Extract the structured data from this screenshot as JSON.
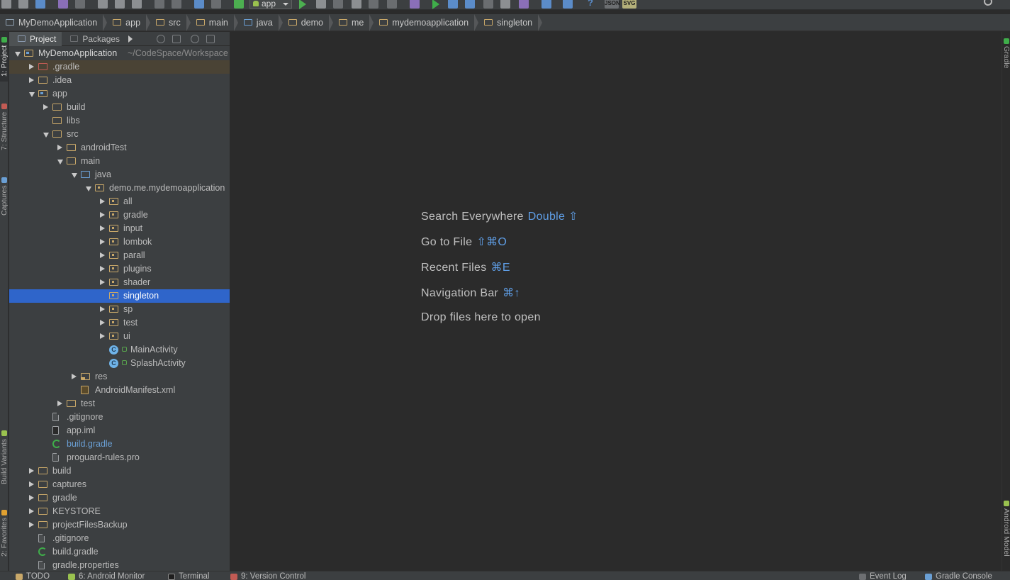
{
  "toolbar": {
    "run_config": "app",
    "json_btn": "JSON",
    "svg_btn": "SVG"
  },
  "breadcrumb": [
    "MyDemoApplication",
    "app",
    "src",
    "main",
    "java",
    "demo",
    "me",
    "mydemoapplication",
    "singleton"
  ],
  "left_stripe": {
    "project_tab": "1: Project",
    "structure_tab": "7: Structure",
    "captures_tab": "Captures",
    "build_variants_tab": "Build Variants",
    "favorites_tab": "2: Favorites"
  },
  "right_stripe": {
    "gradle_tab": "Gradle",
    "android_model_tab": "Android Model"
  },
  "panel": {
    "tab_project": "Project",
    "tab_packages": "Packages"
  },
  "tree": [
    {
      "label": "MyDemoApplication",
      "path": "~/CodeSpace/Workspace",
      "depth": 0,
      "toggle": "down",
      "icon": "mod",
      "root": true
    },
    {
      "label": ".gradle",
      "depth": 1,
      "toggle": "right",
      "icon": "gradle-dir",
      "highlight": true
    },
    {
      "label": ".idea",
      "depth": 1,
      "toggle": "right",
      "icon": "dir"
    },
    {
      "label": "app",
      "depth": 1,
      "toggle": "down",
      "icon": "mod"
    },
    {
      "label": "build",
      "depth": 2,
      "toggle": "right",
      "icon": "dir"
    },
    {
      "label": "libs",
      "depth": 2,
      "toggle": "none",
      "icon": "dir"
    },
    {
      "label": "src",
      "depth": 2,
      "toggle": "down",
      "icon": "dir"
    },
    {
      "label": "androidTest",
      "depth": 3,
      "toggle": "right",
      "icon": "dir"
    },
    {
      "label": "main",
      "depth": 3,
      "toggle": "down",
      "icon": "dir"
    },
    {
      "label": "java",
      "depth": 4,
      "toggle": "down",
      "icon": "src"
    },
    {
      "label": "demo.me.mydemoapplication",
      "depth": 5,
      "toggle": "down",
      "icon": "pkg"
    },
    {
      "label": "all",
      "depth": 6,
      "toggle": "right",
      "icon": "pkg"
    },
    {
      "label": "gradle",
      "depth": 6,
      "toggle": "right",
      "icon": "pkg"
    },
    {
      "label": "input",
      "depth": 6,
      "toggle": "right",
      "icon": "pkg"
    },
    {
      "label": "lombok",
      "depth": 6,
      "toggle": "right",
      "icon": "pkg"
    },
    {
      "label": "parall",
      "depth": 6,
      "toggle": "right",
      "icon": "pkg"
    },
    {
      "label": "plugins",
      "depth": 6,
      "toggle": "right",
      "icon": "pkg"
    },
    {
      "label": "shader",
      "depth": 6,
      "toggle": "right",
      "icon": "pkg"
    },
    {
      "label": "singleton",
      "depth": 6,
      "toggle": "none",
      "icon": "pkg",
      "selected": true
    },
    {
      "label": "sp",
      "depth": 6,
      "toggle": "right",
      "icon": "pkg"
    },
    {
      "label": "test",
      "depth": 6,
      "toggle": "right",
      "icon": "pkg"
    },
    {
      "label": "ui",
      "depth": 6,
      "toggle": "right",
      "icon": "pkg"
    },
    {
      "label": "MainActivity",
      "depth": 6,
      "toggle": "none",
      "icon": "cls",
      "lock": true
    },
    {
      "label": "SplashActivity",
      "depth": 6,
      "toggle": "none",
      "icon": "cls",
      "lock": true
    },
    {
      "label": "res",
      "depth": 4,
      "toggle": "right",
      "icon": "res"
    },
    {
      "label": "AndroidManifest.xml",
      "depth": 4,
      "toggle": "none",
      "icon": "xml"
    },
    {
      "label": "test",
      "depth": 3,
      "toggle": "right",
      "icon": "dir"
    },
    {
      "label": ".gitignore",
      "depth": 2,
      "toggle": "none",
      "icon": "file"
    },
    {
      "label": "app.iml",
      "depth": 2,
      "toggle": "none",
      "icon": "iml"
    },
    {
      "label": "build.gradle",
      "depth": 2,
      "toggle": "none",
      "icon": "grad",
      "gradle": true
    },
    {
      "label": "proguard-rules.pro",
      "depth": 2,
      "toggle": "none",
      "icon": "file"
    },
    {
      "label": "build",
      "depth": 1,
      "toggle": "right",
      "icon": "dir"
    },
    {
      "label": "captures",
      "depth": 1,
      "toggle": "right",
      "icon": "dir"
    },
    {
      "label": "gradle",
      "depth": 1,
      "toggle": "right",
      "icon": "dir"
    },
    {
      "label": "KEYSTORE",
      "depth": 1,
      "toggle": "right",
      "icon": "dir"
    },
    {
      "label": "projectFilesBackup",
      "depth": 1,
      "toggle": "right",
      "icon": "dir"
    },
    {
      "label": ".gitignore",
      "depth": 1,
      "toggle": "none",
      "icon": "file"
    },
    {
      "label": "build.gradle",
      "depth": 1,
      "toggle": "none",
      "icon": "grad"
    },
    {
      "label": "gradle.properties",
      "depth": 1,
      "toggle": "none",
      "icon": "file"
    }
  ],
  "editor": {
    "hints": [
      {
        "label": "Search Everywhere",
        "shortcut": "Double ⇧"
      },
      {
        "label": "Go to File",
        "shortcut": "⇧⌘O"
      },
      {
        "label": "Recent Files",
        "shortcut": "⌘E"
      },
      {
        "label": "Navigation Bar",
        "shortcut": "⌘↑"
      },
      {
        "label": "Drop files here to open",
        "shortcut": ""
      }
    ]
  },
  "statusbar": {
    "todo": "TODO",
    "android_monitor": "6: Android Monitor",
    "terminal": "Terminal",
    "version_control": "9: Version Control",
    "event_log": "Event Log",
    "gradle_console": "Gradle Console"
  }
}
